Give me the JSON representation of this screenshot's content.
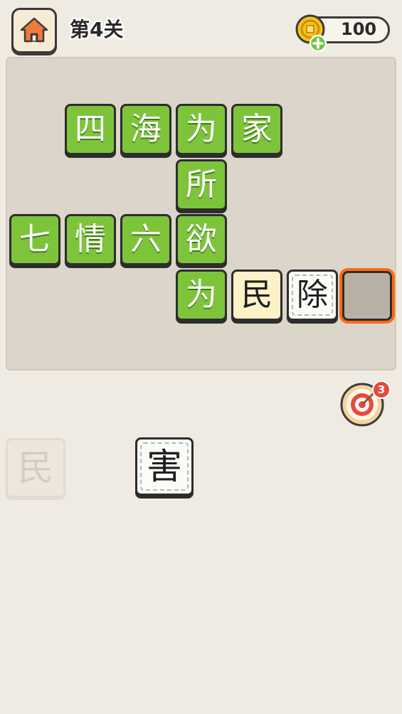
{
  "header": {
    "level_title": "第4关",
    "coins": "100"
  },
  "board": {
    "tiles": [
      {
        "char": "四",
        "style": "green"
      },
      {
        "char": "海",
        "style": "green"
      },
      {
        "char": "为",
        "style": "green"
      },
      {
        "char": "家",
        "style": "green"
      },
      {
        "char": "所",
        "style": "green"
      },
      {
        "char": "七",
        "style": "green"
      },
      {
        "char": "情",
        "style": "green"
      },
      {
        "char": "六",
        "style": "green"
      },
      {
        "char": "欲",
        "style": "green"
      },
      {
        "char": "为",
        "style": "green"
      },
      {
        "char": "民",
        "style": "cream"
      },
      {
        "char": "除",
        "style": "white"
      },
      {
        "char": "",
        "style": "empty-selected"
      }
    ]
  },
  "hint": {
    "count": "3"
  },
  "bank": {
    "tiles": [
      {
        "char": "民",
        "state": "used"
      },
      {
        "char": "害",
        "state": "available"
      }
    ]
  },
  "colors": {
    "background": "#f0ebe2",
    "board": "#dcd5c9",
    "tile_green": "#7ec43b",
    "tile_cream": "#fdf1c8",
    "selected_outline": "#ff6a13",
    "home_icon": "#f07a3a",
    "hint_badge": "#e74a3b"
  },
  "icons": {
    "home": "home-icon",
    "coin": "coin-icon",
    "add": "plus-icon",
    "hint": "target-icon"
  }
}
